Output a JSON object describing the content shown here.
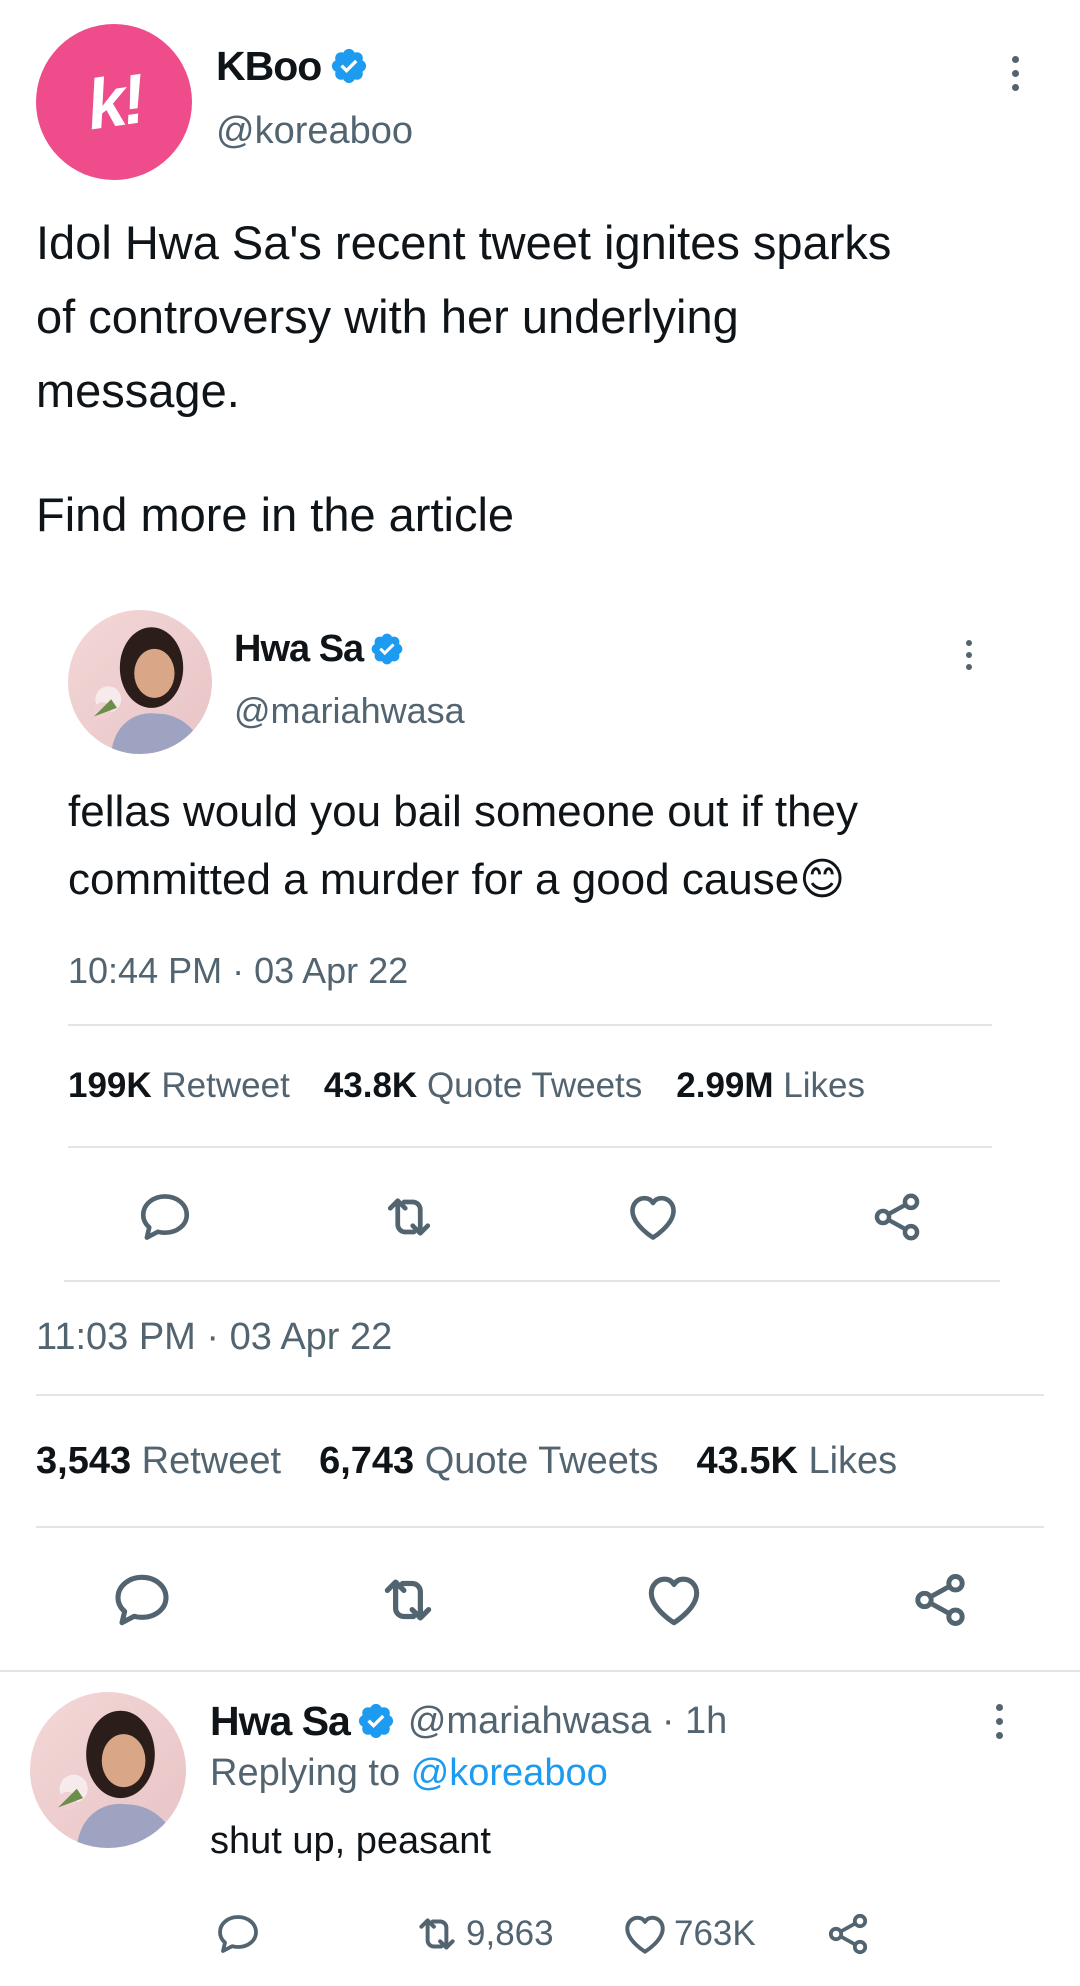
{
  "outer_tweet": {
    "display_name": "KBoo",
    "handle": "@koreaboo",
    "avatar_letter": "k!",
    "text_line1": "Idol Hwa Sa's recent tweet ignites sparks",
    "text_line2": "of controversy with her underlying",
    "text_line3": "message.",
    "text_line4": "Find more in the article",
    "timestamp": "11:03 PM · 03 Apr 22",
    "retweets": "3,543",
    "retweets_label": "Retweet",
    "quotes": "6,743",
    "quotes_label": "Quote Tweets",
    "likes": "43.5K",
    "likes_label": "Likes"
  },
  "quoted_tweet": {
    "display_name": "Hwa Sa",
    "handle": "@mariahwasa",
    "text_line1": "fellas would you bail someone out if they",
    "text_line2": "committed a murder for a good cause",
    "emoji": "😊",
    "timestamp": "10:44 PM · 03 Apr 22",
    "retweets": "199K",
    "retweets_label": "Retweet",
    "quotes": "43.8K",
    "quotes_label": "Quote Tweets",
    "likes": "2.99M",
    "likes_label": "Likes"
  },
  "reply": {
    "display_name": "Hwa Sa",
    "handle_time": "@mariahwasa · 1h",
    "replying_prefix": "Replying to",
    "replying_to": "@koreaboo",
    "text": "shut up, peasant",
    "retweet_count": "9,863",
    "like_count": "763K"
  },
  "colors": {
    "accent": "#1d9bf0",
    "kboo_pink": "#ee4c8b",
    "muted": "#536471",
    "divider": "#e1e5e8"
  },
  "icons": [
    "verified-badge-icon",
    "more-options-icon",
    "reply-icon",
    "retweet-icon",
    "like-icon",
    "share-icon"
  ]
}
